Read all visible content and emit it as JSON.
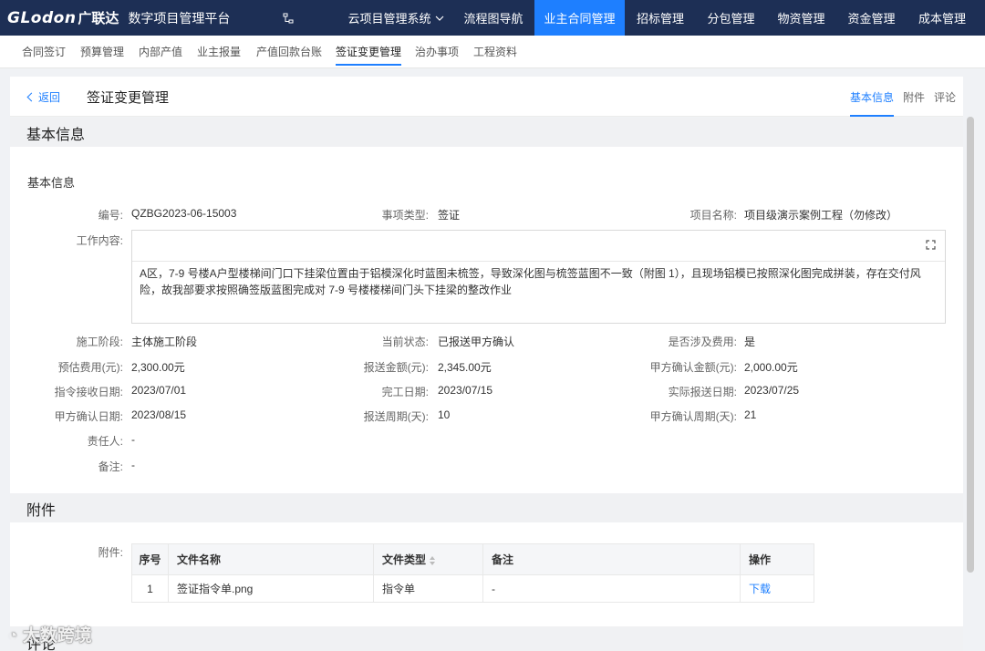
{
  "topnav": {
    "logo_en": "GLodon",
    "logo_cn": "广联达",
    "platform": "数字项目管理平台",
    "system_menu": "云项目管理系统",
    "items": [
      {
        "label": "流程图导航"
      },
      {
        "label": "业主合同管理"
      },
      {
        "label": "招标管理"
      },
      {
        "label": "分包管理"
      },
      {
        "label": "物资管理"
      },
      {
        "label": "资金管理"
      },
      {
        "label": "成本管理"
      }
    ],
    "active_color": "#1e7fff",
    "bg_color": "#1d2f55"
  },
  "subnav": {
    "items": [
      {
        "label": "合同签订"
      },
      {
        "label": "预算管理"
      },
      {
        "label": "内部产值"
      },
      {
        "label": "业主报量"
      },
      {
        "label": "产值回款台账"
      },
      {
        "label": "签证变更管理"
      },
      {
        "label": "治办事项"
      },
      {
        "label": "工程资料"
      }
    ]
  },
  "header": {
    "back": "返回",
    "title": "签证变更管理",
    "tabs": [
      {
        "label": "基本信息"
      },
      {
        "label": "附件"
      },
      {
        "label": "评论"
      }
    ]
  },
  "sections": {
    "basic": "基本信息",
    "attach": "附件",
    "comment": "评论"
  },
  "basic": {
    "subtitle": "基本信息",
    "fields": {
      "code": {
        "label": "编号:",
        "value": "QZBG2023-06-15003"
      },
      "type": {
        "label": "事项类型:",
        "value": "签证"
      },
      "project": {
        "label": "项目名称:",
        "value": "项目级演示案例工程（勿修改）"
      },
      "content_label": "工作内容:",
      "content": "A区，7-9 号楼A户型楼梯间门口下挂梁位置由于铝模深化时蓝图未梳签，导致深化图与梳签蓝图不一致（附图 1），且现场铝模已按照深化图完成拼装，存在交付风险，故我部要求按照确签版蓝图完成对 7-9 号楼楼梯间门头下挂梁的整改作业",
      "stage": {
        "label": "施工阶段:",
        "value": "主体施工阶段"
      },
      "status": {
        "label": "当前状态:",
        "value": "已报送甲方确认"
      },
      "cost": {
        "label": "是否涉及费用:",
        "value": "是"
      },
      "est": {
        "label": "预估费用(元):",
        "value": "2,300.00元"
      },
      "report_amt": {
        "label": "报送金额(元):",
        "value": "2,345.00元"
      },
      "confirm_amt": {
        "label": "甲方确认金额(元):",
        "value": "2,000.00元"
      },
      "recv_date": {
        "label": "指令接收日期:",
        "value": "2023/07/01"
      },
      "finish_date": {
        "label": "完工日期:",
        "value": "2023/07/15"
      },
      "report_date": {
        "label": "实际报送日期:",
        "value": "2023/07/25"
      },
      "confirm_date": {
        "label": "甲方确认日期:",
        "value": "2023/08/15"
      },
      "report_days": {
        "label": "报送周期(天):",
        "value": "10"
      },
      "confirm_days": {
        "label": "甲方确认周期(天):",
        "value": "21"
      },
      "owner": {
        "label": "责任人:",
        "value": "-"
      },
      "remark": {
        "label": "备注:",
        "value": "-"
      }
    }
  },
  "attachments": {
    "label": "附件:",
    "columns": [
      "序号",
      "文件名称",
      "文件类型",
      "备注",
      "操作"
    ],
    "rows": [
      {
        "idx": "1",
        "name": "签证指令单.png",
        "type": "指令单",
        "remark": "-",
        "action": "下载"
      }
    ]
  },
  "watermark": "大数跨境"
}
